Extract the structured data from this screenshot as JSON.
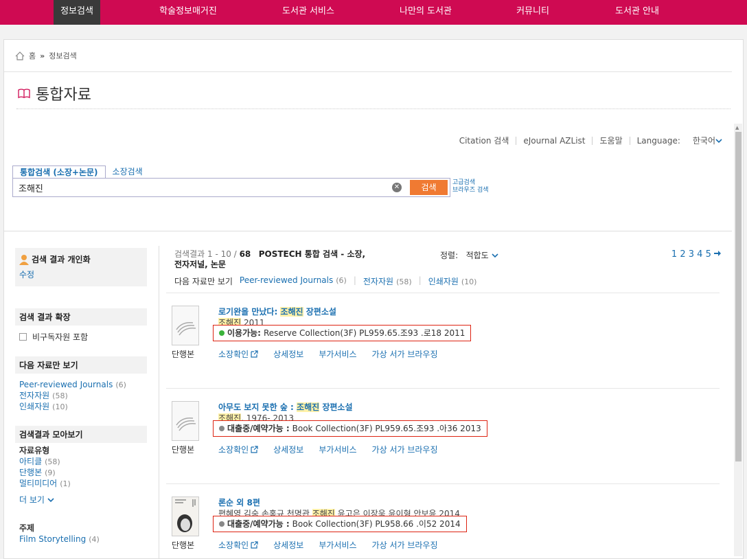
{
  "nav": {
    "items": [
      "정보검색",
      "학술정보매거진",
      "도서관 서비스",
      "나만의 도서관",
      "커뮤니티",
      "도서관 안내"
    ]
  },
  "breadcrumb": {
    "home": "홈",
    "current": "정보검색"
  },
  "page_title": "통합자료",
  "utility": {
    "citation": "Citation 검색",
    "ejournal": "eJournal AZList",
    "help": "도움말",
    "language_label": "Language:",
    "language_value": "한국어"
  },
  "search": {
    "tab_integrated": "통합검색 (소장+논문)",
    "tab_holdings": "소장검색",
    "query": "조해진",
    "button": "검색",
    "advanced": "고급검색",
    "browse": "브라우즈 검색"
  },
  "sidebar": {
    "personalize_title": "검색 결과 개인화",
    "edit": "수정",
    "expand_title": "검색 결과 확장",
    "nonholding_label": "비구독자원 포함",
    "only_title": "다음 자료만 보기",
    "only_items": [
      {
        "label": "Peer-reviewed Journals",
        "count": "(6)"
      },
      {
        "label": "전자자원",
        "count": "(58)"
      },
      {
        "label": "인쇄자원",
        "count": "(10)"
      }
    ],
    "facet_title": "검색결과 모아보기",
    "type_title": "자료유형",
    "type_items": [
      {
        "label": "아티클",
        "count": "(58)"
      },
      {
        "label": "단행본",
        "count": "(9)"
      },
      {
        "label": "멀티미디어",
        "count": "(1)"
      }
    ],
    "more": "더 보기",
    "subject_title": "주제",
    "subject_items": [
      {
        "label": "Film Storytelling",
        "count": "(4)"
      }
    ]
  },
  "results": {
    "range_label": "검색결과",
    "range": "1 - 10 /",
    "total": "68",
    "scope": "POSTECH 통합 검색 - 소장, 전자저널, 논문",
    "sort_label": "정렬:",
    "sort_value": "적합도",
    "pages": [
      "1",
      "2",
      "3",
      "4",
      "5"
    ],
    "filter_label": "다음 자료만 보기",
    "filters": [
      {
        "label": "Peer-reviewed Journals",
        "count": "(6)"
      },
      {
        "label": "전자자원",
        "count": "(58)"
      },
      {
        "label": "인쇄자원",
        "count": "(10)"
      }
    ]
  },
  "records": [
    {
      "title_pre": "로기완을 만났다:",
      "title_hl": "조해진",
      "title_post": "장편소설",
      "author_hl": "조해진",
      "author_rest": " 2011",
      "status": "이용가능:",
      "status_color": "#3bb33b",
      "location": "Reserve Collection(3F) PL959.65.조93 .로18 2011",
      "type": "단행본",
      "actions": [
        "소장확인",
        "상세정보",
        "부가서비스",
        "가상 서가 브라우징"
      ]
    },
    {
      "title_pre": "아무도 보지 못한 숲 :",
      "title_hl": "조해진",
      "title_post": "장편소설",
      "author_hl": "조해진",
      "author_rest": ", 1976-  2013",
      "status": "대출중/예약가능 :",
      "status_color": "#888888",
      "location": "Book Collection(3F) PL959.65.조93 .아36 2013",
      "type": "단행본",
      "actions": [
        "소장확인",
        "상세정보",
        "부가서비스",
        "가상 서가 브라우징"
      ]
    },
    {
      "title_pre": "론순 외 8편",
      "title_hl": "",
      "title_post": "",
      "author_pre": "편혜영 김숨 손홍규 천명관 ",
      "author_hl": "조해진",
      "author_rest": " 윤고은 이장욱 윤이형 안보윤 2014",
      "status": "대출중/예약가능 :",
      "status_color": "#888888",
      "location": "Book Collection(3F) PL958.66 .이52 2014",
      "type": "단행본",
      "actions": [
        "소장확인",
        "상세정보",
        "부가서비스",
        "가상 서가 브라우징"
      ]
    }
  ]
}
